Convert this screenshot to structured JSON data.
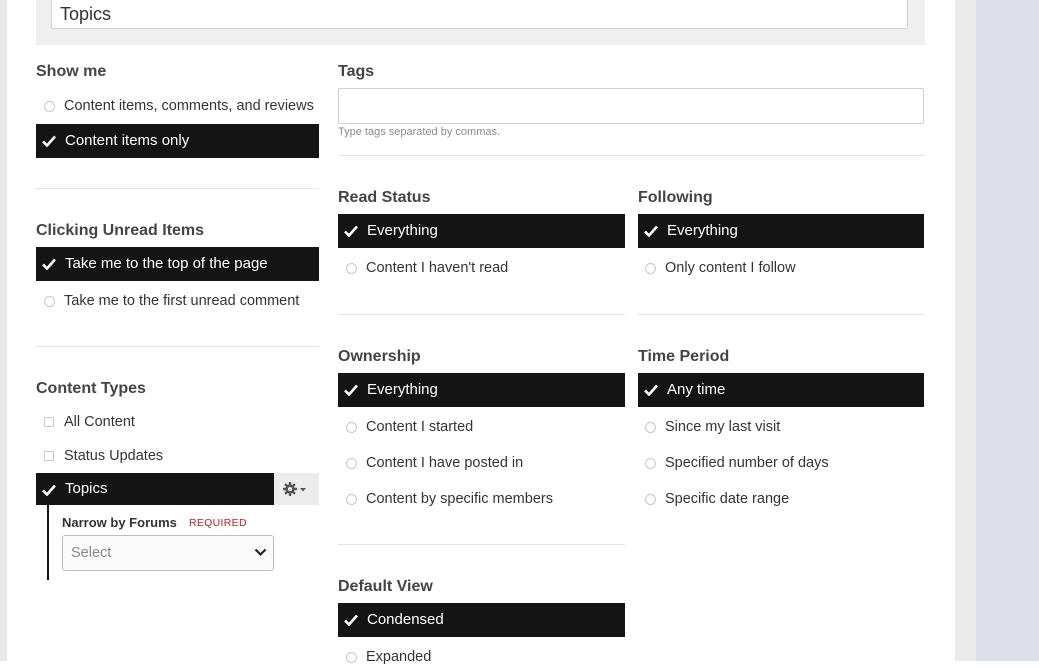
{
  "top_field": {
    "value": "Topics"
  },
  "show_me": {
    "heading": "Show me",
    "options": [
      {
        "label": "Content items, comments, and reviews",
        "selected": false
      },
      {
        "label": "Content items only",
        "selected": true
      }
    ]
  },
  "tags": {
    "heading": "Tags",
    "value": "",
    "hint": "Type tags separated by commas."
  },
  "clicking_unread": {
    "heading": "Clicking Unread Items",
    "options": [
      {
        "label": "Take me to the top of the page",
        "selected": true
      },
      {
        "label": "Take me to the first unread comment",
        "selected": false
      }
    ]
  },
  "read_status": {
    "heading": "Read Status",
    "options": [
      {
        "label": "Everything",
        "selected": true
      },
      {
        "label": "Content I haven't read",
        "selected": false
      }
    ]
  },
  "following": {
    "heading": "Following",
    "options": [
      {
        "label": "Everything",
        "selected": true
      },
      {
        "label": "Only content I follow",
        "selected": false
      }
    ]
  },
  "content_types": {
    "heading": "Content Types",
    "options": [
      {
        "label": "All Content",
        "selected": false
      },
      {
        "label": "Status Updates",
        "selected": false
      },
      {
        "label": "Topics",
        "selected": true
      }
    ],
    "narrow": {
      "label": "Narrow by Forums",
      "required": "REQUIRED",
      "select_value": "Select"
    }
  },
  "ownership": {
    "heading": "Ownership",
    "options": [
      {
        "label": "Everything",
        "selected": true
      },
      {
        "label": "Content I started",
        "selected": false
      },
      {
        "label": "Content I have posted in",
        "selected": false
      },
      {
        "label": "Content by specific members",
        "selected": false
      }
    ]
  },
  "time_period": {
    "heading": "Time Period",
    "options": [
      {
        "label": "Any time",
        "selected": true
      },
      {
        "label": "Since my last visit",
        "selected": false
      },
      {
        "label": "Specified number of days",
        "selected": false
      },
      {
        "label": "Specific date range",
        "selected": false
      }
    ]
  },
  "default_view": {
    "heading": "Default View",
    "options": [
      {
        "label": "Condensed",
        "selected": true
      },
      {
        "label": "Expanded",
        "selected": false
      }
    ]
  },
  "colors": {
    "selected_bg": "#141414",
    "required": "#b02424",
    "sidebar": "#dde0ea"
  }
}
